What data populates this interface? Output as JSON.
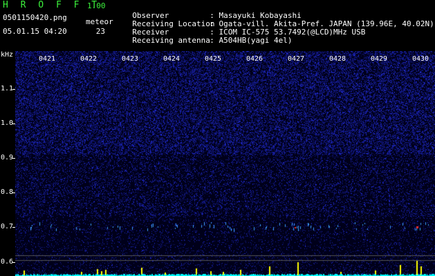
{
  "header": {
    "app_title": "H R O F F T",
    "app_version": "1.00",
    "file_name": "0501150420.png",
    "timestamp": "05.01.15 04:20",
    "meteor_label": "meteor",
    "meteor_count": "23"
  },
  "info": [
    {
      "label": "Observer",
      "value": ": Masayuki Kobayashi"
    },
    {
      "label": "Receiving Location",
      "value": ": Ogata-vill. Akita-Pref. JAPAN (139.96E, 40.02N)"
    },
    {
      "label": "Receiver",
      "value": ": ICOM IC-575 53.7492(@LCD)MHz USB"
    },
    {
      "label": "Receiving antenna",
      "value": ": A504HB(yagi 4el)"
    }
  ],
  "axis": {
    "y_unit": "kHz",
    "y_ticks": [
      "1.1",
      "1.0",
      "0.9",
      "0.8",
      "0.7",
      "0.6"
    ],
    "x_ticks": [
      "0421",
      "0422",
      "0423",
      "0424",
      "0425",
      "0426",
      "0427",
      "0428",
      "0429",
      "0430"
    ]
  },
  "colors": {
    "noise": "#1a22c8",
    "echo": "#3fa0ff",
    "hot": "#ff3030",
    "bars": "#ffff00",
    "baseline": "#00ffff"
  }
}
